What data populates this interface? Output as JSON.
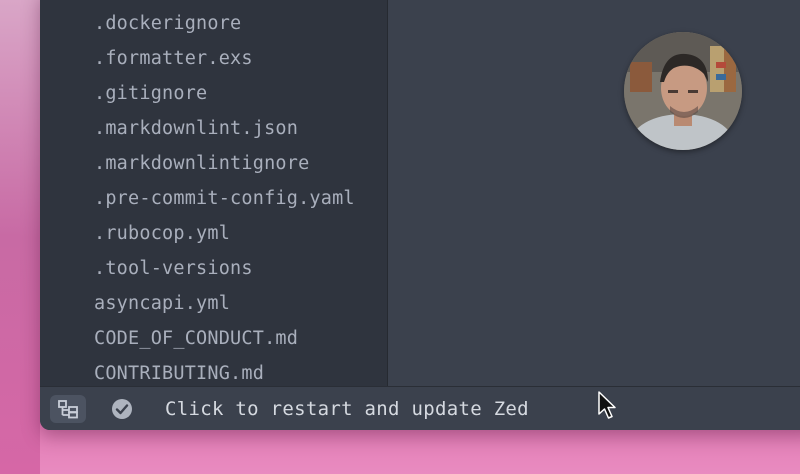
{
  "project_panel": {
    "files": [
      ".dockerignore",
      ".formatter.exs",
      ".gitignore",
      ".markdownlint.json",
      ".markdownlintignore",
      ".pre-commit-config.yaml",
      ".rubocop.yml",
      ".tool-versions",
      "asyncapi.yml",
      "CODE_OF_CONDUCT.md",
      "CONTRIBUTING.md"
    ]
  },
  "status_bar": {
    "update_message": "Click to restart and update Zed",
    "project_icon": "project-tree-icon",
    "check_icon": "check-circle-icon"
  },
  "colors": {
    "panel_bg": "#2f343e",
    "editor_bg": "#3b414d",
    "file_text": "#a9afbc",
    "status_text": "#d5d9e0"
  }
}
